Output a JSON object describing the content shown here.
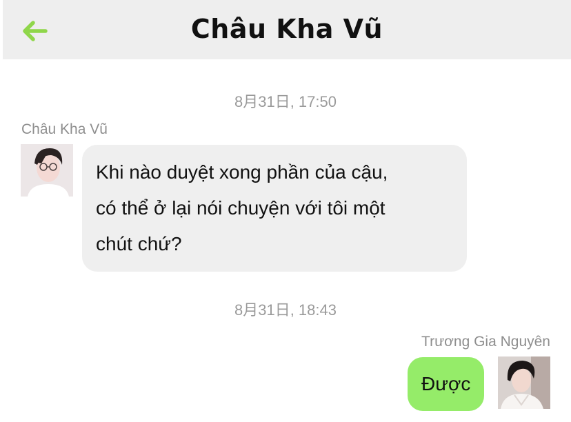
{
  "header": {
    "title": "Châu Kha Vũ",
    "back_icon": "arrow-left-icon",
    "accent_color": "#8fd64a"
  },
  "messages": [
    {
      "timestamp": "8月31日, 17:50",
      "sender": "Châu Kha Vũ",
      "direction": "incoming",
      "lines": [
        "Khi nào duyệt xong phần của cậu,",
        "có thể ở lại nói chuyện với tôi một",
        "chút chứ?"
      ]
    },
    {
      "timestamp": "8月31日, 18:43",
      "sender": "Trương Gia Nguyên",
      "direction": "outgoing",
      "text": "Được"
    }
  ],
  "colors": {
    "incoming_bubble": "#efefef",
    "outgoing_bubble": "#95ec69",
    "header_bg": "#eeeeee"
  }
}
